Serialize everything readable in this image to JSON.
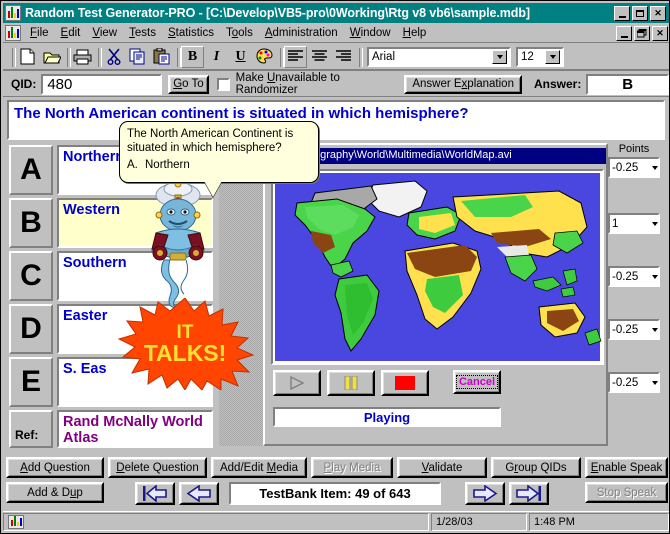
{
  "window": {
    "title": "Random Test Generator-PRO  -  [C:\\Develop\\VB5-pro\\0Working\\Rtg v8 vb6\\sample.mdb]",
    "app_icon": "chart-icon",
    "minimize": "_",
    "maximize": "maximize-icon",
    "close": "✕",
    "mdi_minimize": "_",
    "mdi_restore": "restore-icon",
    "mdi_close": "✕"
  },
  "menu": {
    "items": [
      {
        "label": "File",
        "accel": "F"
      },
      {
        "label": "Edit",
        "accel": "E"
      },
      {
        "label": "View",
        "accel": "V"
      },
      {
        "label": "Tests",
        "accel": "T"
      },
      {
        "label": "Statistics",
        "accel": "S"
      },
      {
        "label": "Tools",
        "accel": "o"
      },
      {
        "label": "Administration",
        "accel": "A"
      },
      {
        "label": "Window",
        "accel": "W"
      },
      {
        "label": "Help",
        "accel": "H"
      }
    ]
  },
  "toolbar": {
    "buttons": [
      {
        "name": "new-icon",
        "title": "New"
      },
      {
        "name": "open-folder-icon",
        "title": "Open"
      },
      {
        "name": "print-icon",
        "title": "Print"
      },
      {
        "name": "cut-scissors-icon",
        "title": "Cut"
      },
      {
        "name": "copy-icon",
        "title": "Copy"
      },
      {
        "name": "paste-icon",
        "title": "Paste"
      },
      {
        "name": "bold-icon",
        "title": "Bold",
        "glyph": "B"
      },
      {
        "name": "italic-icon",
        "title": "Italic",
        "glyph": "I"
      },
      {
        "name": "underline-icon",
        "title": "Underline",
        "glyph": "U"
      },
      {
        "name": "color-palette-icon",
        "title": "Color"
      },
      {
        "name": "align-left-icon",
        "title": "Align Left"
      },
      {
        "name": "align-center-icon",
        "title": "Align Center"
      },
      {
        "name": "align-right-icon",
        "title": "Align Right"
      }
    ],
    "font_name": "Arial",
    "font_size": "12"
  },
  "qid_row": {
    "qid_label": "QID:",
    "qid_value": "480",
    "goto_label": "Go To",
    "goto_accel": "G",
    "unavailable_label": "Make Unavailable to Randomizer",
    "unavailable_checked": false,
    "answer_explanation_label": "Answer Explanation",
    "answer_label": "Answer:",
    "answer_value": "B"
  },
  "question": {
    "text": "The North American continent is situated in which hemisphere?"
  },
  "balloon": {
    "line1": "The North American Continent is",
    "line2": "situated in which hemisphere?",
    "option_key": "A.",
    "option_text": "Northern"
  },
  "answers": {
    "points_header": "Points",
    "rows": [
      {
        "letter": "A",
        "text": "Northern",
        "points": "-0.25",
        "highlight": false
      },
      {
        "letter": "B",
        "text": "Western",
        "points": "1",
        "highlight": true
      },
      {
        "letter": "C",
        "text": "Southern",
        "points": "-0.25",
        "highlight": false
      },
      {
        "letter": "D",
        "text": "Easter",
        "points": "-0.25",
        "highlight": false
      },
      {
        "letter": "E",
        "text": "S. Eas",
        "points": "-0.25",
        "highlight": false
      }
    ],
    "ref_label": "Ref:",
    "ref_text": "Rand McNally World Atlas"
  },
  "media": {
    "path": "anks\\Geography\\World\\Multimedia\\WorldMap.avi",
    "image_name": "world-map-video-frame",
    "controls": [
      {
        "name": "play-button",
        "glyph": "play",
        "disabled": true
      },
      {
        "name": "pause-button",
        "glyph": "pause",
        "disabled": false
      },
      {
        "name": "stop-button",
        "glyph": "stop",
        "disabled": false
      }
    ],
    "cancel_label": "Cancel",
    "status": "Playing"
  },
  "starburst": {
    "line1": "IT",
    "line2": "TALKS!"
  },
  "bottom_buttons": [
    {
      "label": "Add Question",
      "accel": "A",
      "disabled": false,
      "name": "add-question-button"
    },
    {
      "label": "Delete Question",
      "accel": "D",
      "disabled": false,
      "name": "delete-question-button"
    },
    {
      "label": "Add/Edit Media",
      "accel": "M",
      "disabled": false,
      "name": "add-edit-media-button"
    },
    {
      "label": "Play Media",
      "accel": "P",
      "disabled": true,
      "name": "play-media-button"
    },
    {
      "label": "Validate",
      "accel": "V",
      "disabled": false,
      "name": "validate-button"
    },
    {
      "label": "Group QIDs",
      "accel": "r",
      "disabled": false,
      "name": "group-qids-button"
    },
    {
      "label": "Enable Speak",
      "accel": "E",
      "disabled": false,
      "name": "enable-speak-button"
    }
  ],
  "bottom_row2": {
    "add_dup_label": "Add & Dup",
    "add_dup_accel": "u",
    "stop_speak_label": "Stop Speak",
    "stop_speak_disabled": true,
    "item_counter": "TestBank Item: 49 of 643",
    "nav": [
      {
        "name": "nav-first-button",
        "glyph": "first"
      },
      {
        "name": "nav-prev-button",
        "glyph": "prev"
      },
      {
        "name": "nav-next-button",
        "glyph": "next"
      },
      {
        "name": "nav-last-button",
        "glyph": "last"
      }
    ]
  },
  "statusbar": {
    "icon": "chart-icon",
    "message": "",
    "date": "1/28/03",
    "time": "1:48 PM"
  },
  "colors": {
    "titlebar": "#008080",
    "face": "#c0c0c0",
    "question_text": "#0000cc",
    "ref_text": "#800080",
    "highlight_row": "#ffffcc",
    "media_path_bg": "#000080",
    "starburst": "#ff4500",
    "starburst_text": "#ffe033",
    "sea": "#4a46e0"
  }
}
